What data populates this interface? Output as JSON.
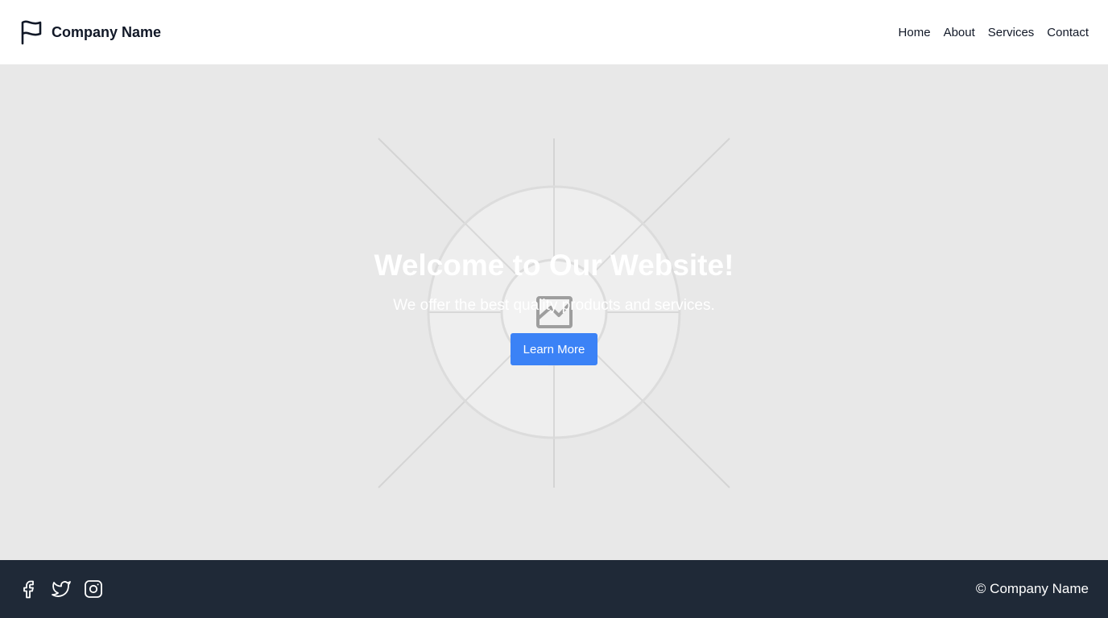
{
  "header": {
    "brand_name": "Company Name",
    "logo_icon": "flag-icon",
    "nav": [
      {
        "label": "Home"
      },
      {
        "label": "About"
      },
      {
        "label": "Services"
      },
      {
        "label": "Contact"
      }
    ]
  },
  "hero": {
    "title": "Welcome to Our Website!",
    "subtitle": "We offer the best quality products and services.",
    "cta_label": "Learn More",
    "background_icon": "image-placeholder-icon"
  },
  "footer": {
    "social": [
      {
        "icon": "facebook-icon"
      },
      {
        "icon": "twitter-icon"
      },
      {
        "icon": "instagram-icon"
      }
    ],
    "copyright": "© Company Name"
  },
  "colors": {
    "accent": "#3b82f6",
    "footer_bg": "#1f2937",
    "hero_bg": "#e8e8e8"
  }
}
